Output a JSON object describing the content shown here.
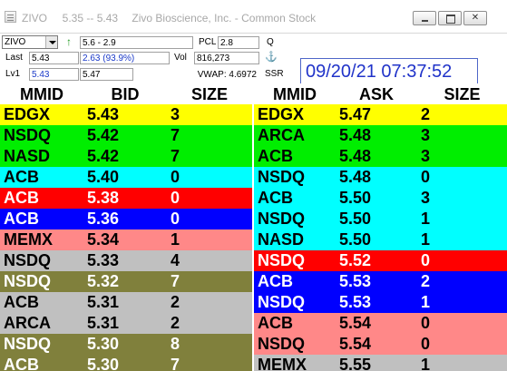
{
  "window": {
    "symbol_prices": "ZIVO     5.35 -- 5.43",
    "company": "Zivo Bioscience, Inc. - Common Stock"
  },
  "info": {
    "symbol": "ZIVO",
    "range": "5.6 - 2.9",
    "pcl_label": "PCL",
    "pcl": "2.8",
    "q_label": "Q",
    "last_label": "Last",
    "last": "5.43",
    "change": "2.63  (93.9%)",
    "vol_label": "Vol",
    "vol": "816,273",
    "lv1_label": "Lv1",
    "lv1_bid": "5.43",
    "lv1_ask": "5.47",
    "vwap": "VWAP: 4.6972",
    "ssr_label": "SSR",
    "clock": "09/20/21 07:37:52"
  },
  "headers": {
    "bid": {
      "mmid": "MMID",
      "price": "BID",
      "size": "SIZE"
    },
    "ask": {
      "mmid": "MMID",
      "price": "ASK",
      "size": "SIZE"
    }
  },
  "colors": {
    "yellow": "#ffff00",
    "green": "#00ee00",
    "cyan": "#00ffff",
    "red": "#ff0000",
    "blue": "#0000ff",
    "salmon": "#ff8888",
    "gray": "#c0c0c0",
    "olive": "#80803c"
  },
  "bids": [
    {
      "mmid": "EDGX",
      "price": "5.43",
      "size": "3",
      "bg": "#ffff00",
      "fg": "#000000"
    },
    {
      "mmid": "NSDQ",
      "price": "5.42",
      "size": "7",
      "bg": "#00ee00",
      "fg": "#000000"
    },
    {
      "mmid": "NASD",
      "price": "5.42",
      "size": "7",
      "bg": "#00ee00",
      "fg": "#000000"
    },
    {
      "mmid": "ACB",
      "price": "5.40",
      "size": "0",
      "bg": "#00ffff",
      "fg": "#000000"
    },
    {
      "mmid": "ACB",
      "price": "5.38",
      "size": "0",
      "bg": "#ff0000",
      "fg": "#ffffff"
    },
    {
      "mmid": "ACB",
      "price": "5.36",
      "size": "0",
      "bg": "#0000ff",
      "fg": "#ffffff"
    },
    {
      "mmid": "MEMX",
      "price": "5.34",
      "size": "1",
      "bg": "#ff8888",
      "fg": "#000000"
    },
    {
      "mmid": "NSDQ",
      "price": "5.33",
      "size": "4",
      "bg": "#c0c0c0",
      "fg": "#000000"
    },
    {
      "mmid": "NSDQ",
      "price": "5.32",
      "size": "7",
      "bg": "#80803c",
      "fg": "#ffffff"
    },
    {
      "mmid": "ACB",
      "price": "5.31",
      "size": "2",
      "bg": "#c0c0c0",
      "fg": "#000000"
    },
    {
      "mmid": "ARCA",
      "price": "5.31",
      "size": "2",
      "bg": "#c0c0c0",
      "fg": "#000000"
    },
    {
      "mmid": "NSDQ",
      "price": "5.30",
      "size": "8",
      "bg": "#80803c",
      "fg": "#ffffff"
    },
    {
      "mmid": "ACB",
      "price": "5.30",
      "size": "7",
      "bg": "#80803c",
      "fg": "#ffffff"
    }
  ],
  "asks": [
    {
      "mmid": "EDGX",
      "price": "5.47",
      "size": "2",
      "bg": "#ffff00",
      "fg": "#000000"
    },
    {
      "mmid": "ARCA",
      "price": "5.48",
      "size": "3",
      "bg": "#00ee00",
      "fg": "#000000"
    },
    {
      "mmid": "ACB",
      "price": "5.48",
      "size": "3",
      "bg": "#00ee00",
      "fg": "#000000"
    },
    {
      "mmid": "NSDQ",
      "price": "5.48",
      "size": "0",
      "bg": "#00ffff",
      "fg": "#000000"
    },
    {
      "mmid": "ACB",
      "price": "5.50",
      "size": "3",
      "bg": "#00ffff",
      "fg": "#000000"
    },
    {
      "mmid": "NSDQ",
      "price": "5.50",
      "size": "1",
      "bg": "#00ffff",
      "fg": "#000000"
    },
    {
      "mmid": "NASD",
      "price": "5.50",
      "size": "1",
      "bg": "#00ffff",
      "fg": "#000000"
    },
    {
      "mmid": "NSDQ",
      "price": "5.52",
      "size": "0",
      "bg": "#ff0000",
      "fg": "#ffffff"
    },
    {
      "mmid": "ACB",
      "price": "5.53",
      "size": "2",
      "bg": "#0000ff",
      "fg": "#ffffff"
    },
    {
      "mmid": "NSDQ",
      "price": "5.53",
      "size": "1",
      "bg": "#0000ff",
      "fg": "#ffffff"
    },
    {
      "mmid": "ACB",
      "price": "5.54",
      "size": "0",
      "bg": "#ff8888",
      "fg": "#000000"
    },
    {
      "mmid": "NSDQ",
      "price": "5.54",
      "size": "0",
      "bg": "#ff8888",
      "fg": "#000000"
    },
    {
      "mmid": "MEMX",
      "price": "5.55",
      "size": "1",
      "bg": "#c0c0c0",
      "fg": "#000000"
    }
  ]
}
